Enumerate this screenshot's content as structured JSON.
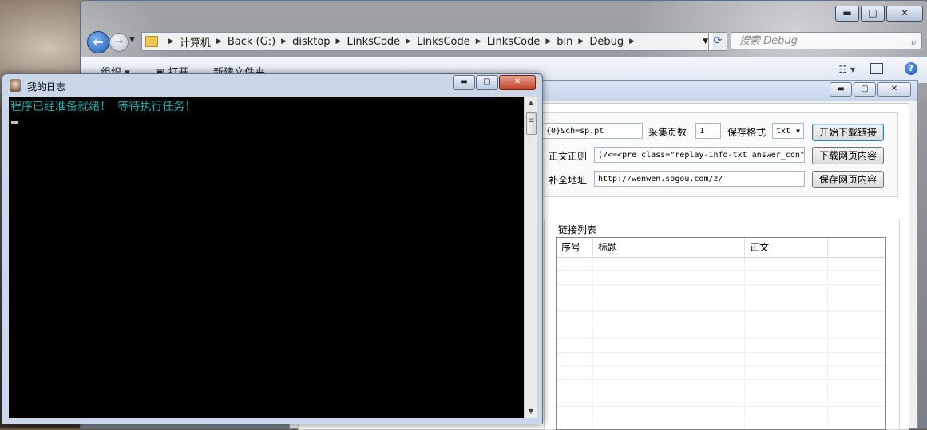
{
  "explorer": {
    "window_buttons": {
      "minimize": "▬",
      "maximize": "□",
      "close": "✕"
    },
    "breadcrumbs": [
      "计算机",
      "Back (G:)",
      "disktop",
      "LinksCode",
      "LinksCode",
      "LinksCode",
      "bin",
      "Debug"
    ],
    "search_placeholder": "搜索 Debug",
    "toolbar": {
      "organize": "组织 ▾",
      "open": "打开",
      "new_folder": "新建文件夹"
    }
  },
  "app": {
    "url_template": "{0}&ch=sp.pt",
    "pages_label": "采集页数",
    "pages_value": "1",
    "format_label": "保存格式",
    "format_value": "txt",
    "start_button": "开始下载链接",
    "regex_label": "正文正则",
    "regex_value": "(?<=<pre class=\"replay-info-txt answer_con\"",
    "download_button": "下载网页内容",
    "complete_label": "补全地址",
    "complete_value": "http://wenwen.sogou.com/z/",
    "save_button": "保存网页内容",
    "list_group": "链接列表",
    "columns": [
      "序号",
      "标题",
      "正文"
    ]
  },
  "console": {
    "title": "我的日志",
    "output": "程序已经准备就绪！ 等待执行任务！"
  },
  "colors": {
    "console_text": "#2aa6a6",
    "console_bg": "#000000",
    "close_button": "#c2412a"
  }
}
